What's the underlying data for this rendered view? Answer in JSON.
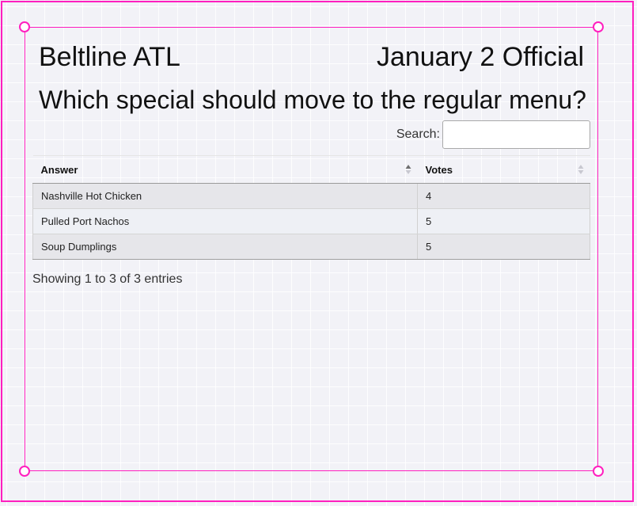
{
  "header": {
    "location": "Beltline ATL",
    "date_label": "January 2 Official"
  },
  "question": "Which special should move to the regular menu?",
  "search": {
    "label": "Search:",
    "value": ""
  },
  "table": {
    "columns": [
      {
        "label": "Answer",
        "sort": "ascending",
        "icon": "sort-asc-icon"
      },
      {
        "label": "Votes",
        "sort": "none",
        "icon": "sort-both-icon"
      }
    ],
    "rows": [
      {
        "answer": "Nashville Hot Chicken",
        "votes": "4"
      },
      {
        "answer": "Pulled Port Nachos",
        "votes": "5"
      },
      {
        "answer": "Soup Dumplings",
        "votes": "5"
      }
    ]
  },
  "info": "Showing 1 to 3 of 3 entries",
  "colors": {
    "selection": "#ff1fbf",
    "sort_active": "#6e6e6e",
    "sort_inactive": "#c8c8d0"
  }
}
